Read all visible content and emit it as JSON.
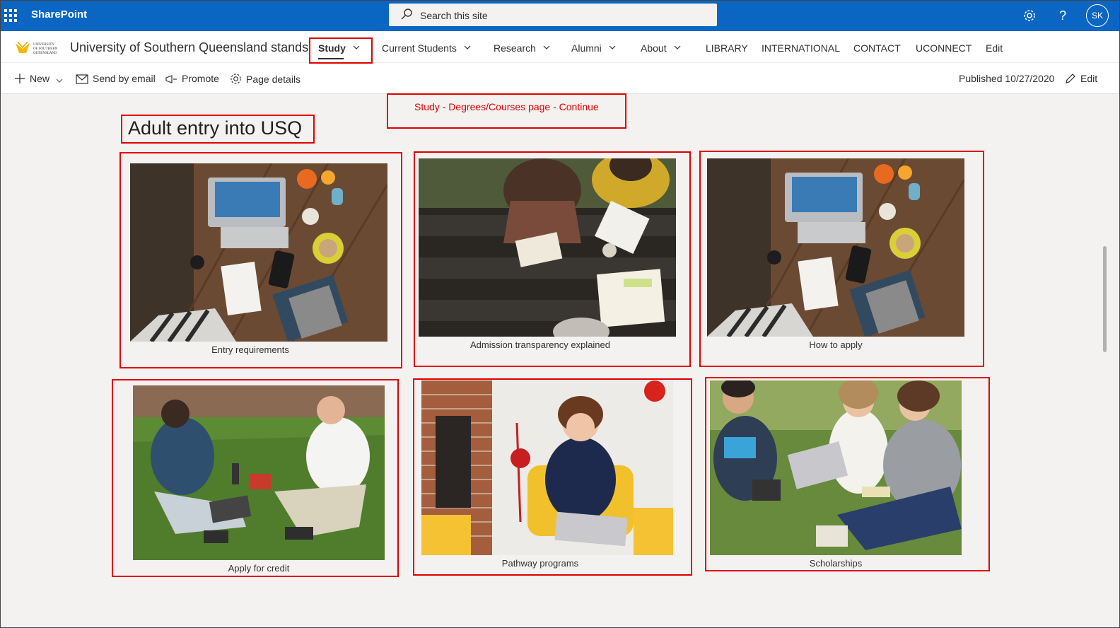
{
  "suitebar": {
    "app_name": "SharePoint",
    "search_placeholder": "Search this site",
    "settings_icon": "gear-icon",
    "help_icon": "question-icon",
    "help_glyph": "?",
    "avatar_initials": "SK"
  },
  "site": {
    "title": "University of Southern Queensland stands",
    "logo_text": "UNIVERSITY OF SOUTHERN QUEENSLAND"
  },
  "nav": {
    "study": "Study",
    "current_students": "Current Students",
    "research": "Research",
    "alumni": "Alumni",
    "about": "About",
    "library": "LIBRARY",
    "international": "INTERNATIONAL",
    "contact": "CONTACT",
    "uconnect": "UCONNECT",
    "edit": "Edit"
  },
  "commandbar": {
    "new": "New",
    "send_by_email": "Send by email",
    "promote": "Promote",
    "page_details": "Page details",
    "published": "Published 10/27/2020",
    "edit": "Edit"
  },
  "annotation": {
    "breadcrumb_note": "Study - Degrees/Courses page  -  Continue"
  },
  "page": {
    "title": "Adult entry into USQ"
  },
  "tiles": [
    {
      "caption": "Entry requirements",
      "photo": "laptop-table-photo"
    },
    {
      "caption": "Admission transparency explained",
      "photo": "students-reading-photo"
    },
    {
      "caption": "How to apply",
      "photo": "laptop-table-photo"
    },
    {
      "caption": "Apply for credit",
      "photo": "students-on-grass-photo"
    },
    {
      "caption": "Pathway programs",
      "photo": "woman-laptop-photo"
    },
    {
      "caption": "Scholarships",
      "photo": "students-group-grass-photo"
    }
  ],
  "colors": {
    "suitebar": "#0a66c2",
    "annotation": "#e00000",
    "background": "#f3f2f1"
  }
}
